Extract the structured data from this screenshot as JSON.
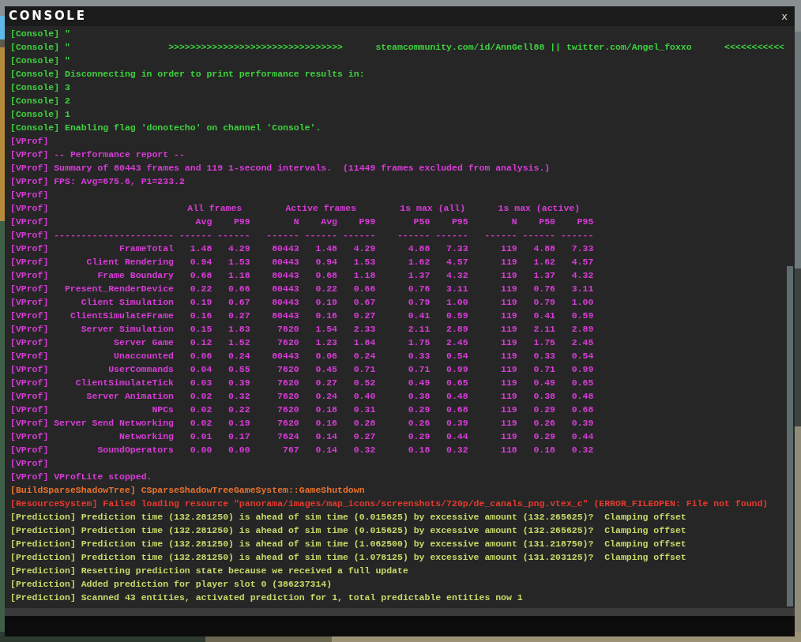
{
  "window": {
    "title": "CONSOLE",
    "close": "x"
  },
  "lines": [
    {
      "kind": "text",
      "color": "#3fd13f",
      "text": "[Console] \""
    },
    {
      "kind": "text",
      "color": "#3fd13f",
      "text": "[Console] \"                  >>>>>>>>>>>>>>>>>>>>>>>>>>>>>>>>      steamcommunity.com/id/AnnGell88 || twitter.com/Angel_foxxo      <<<<<<<<<<<"
    },
    {
      "kind": "text",
      "color": "#3fd13f",
      "text": "[Console] \""
    },
    {
      "kind": "text",
      "color": "#3fd13f",
      "text": "[Console] Disconnecting in order to print performance results in:"
    },
    {
      "kind": "text",
      "color": "#3fd13f",
      "text": "[Console] 3"
    },
    {
      "kind": "text",
      "color": "#3fd13f",
      "text": "[Console] 2"
    },
    {
      "kind": "text",
      "color": "#3fd13f",
      "text": "[Console] 1"
    },
    {
      "kind": "text",
      "color": "#3fd13f",
      "text": "[Console] Enabling flag 'donotecho' on channel 'Console'."
    },
    {
      "kind": "text",
      "color": "#d83cd8",
      "text": "[VProf]"
    },
    {
      "kind": "text",
      "color": "#d83cd8",
      "text": "[VProf] -- Performance report --"
    },
    {
      "kind": "text",
      "color": "#d83cd8",
      "text": "[VProf] Summary of 80443 frames and 119 1-second intervals.  (11449 frames excluded from analysis.)"
    },
    {
      "kind": "text",
      "color": "#d83cd8",
      "text": "[VProf] FPS: Avg=675.6, P1=233.2"
    },
    {
      "kind": "text",
      "color": "#d83cd8",
      "text": "[VProf]"
    },
    {
      "kind": "groups",
      "color": "#d83cd8",
      "prefix": "[VProf]",
      "groups": [
        "All frames",
        "Active frames",
        "1s max (all)",
        "1s max (active)"
      ]
    },
    {
      "kind": "row",
      "color": "#d83cd8",
      "prefix": "[VProf]",
      "values": [
        "Avg",
        "P99",
        "N",
        "Avg",
        "P99",
        "P50",
        "P95",
        "N",
        "P50",
        "P95"
      ]
    },
    {
      "kind": "row",
      "color": "#d83cd8",
      "prefix": "[VProf]",
      "name": "----------------------",
      "values": [
        "------",
        "------",
        "------",
        "------",
        "------",
        "------",
        "------",
        "------",
        "------",
        "------"
      ]
    },
    {
      "kind": "row",
      "color": "#d83cd8",
      "prefix": "[VProf]",
      "name": "FrameTotal",
      "values": [
        "1.48",
        "4.29",
        "80443",
        "1.48",
        "4.29",
        "4.88",
        "7.33",
        "119",
        "4.88",
        "7.33"
      ]
    },
    {
      "kind": "row",
      "color": "#d83cd8",
      "prefix": "[VProf]",
      "name": "Client Rendering",
      "values": [
        "0.94",
        "1.53",
        "80443",
        "0.94",
        "1.53",
        "1.62",
        "4.57",
        "119",
        "1.62",
        "4.57"
      ]
    },
    {
      "kind": "row",
      "color": "#d83cd8",
      "prefix": "[VProf]",
      "name": "Frame Boundary",
      "values": [
        "0.68",
        "1.18",
        "80443",
        "0.68",
        "1.18",
        "1.37",
        "4.32",
        "119",
        "1.37",
        "4.32"
      ]
    },
    {
      "kind": "row",
      "color": "#d83cd8",
      "prefix": "[VProf]",
      "name": "Present_RenderDevice",
      "values": [
        "0.22",
        "0.66",
        "80443",
        "0.22",
        "0.66",
        "0.76",
        "3.11",
        "119",
        "0.76",
        "3.11"
      ]
    },
    {
      "kind": "row",
      "color": "#d83cd8",
      "prefix": "[VProf]",
      "name": "Client Simulation",
      "values": [
        "0.19",
        "0.67",
        "80443",
        "0.19",
        "0.67",
        "0.79",
        "1.00",
        "119",
        "0.79",
        "1.00"
      ]
    },
    {
      "kind": "row",
      "color": "#d83cd8",
      "prefix": "[VProf]",
      "name": "ClientSimulateFrame",
      "values": [
        "0.16",
        "0.27",
        "80443",
        "0.16",
        "0.27",
        "0.41",
        "0.59",
        "119",
        "0.41",
        "0.59"
      ]
    },
    {
      "kind": "row",
      "color": "#d83cd8",
      "prefix": "[VProf]",
      "name": "Server Simulation",
      "values": [
        "0.15",
        "1.83",
        "7620",
        "1.54",
        "2.33",
        "2.11",
        "2.89",
        "119",
        "2.11",
        "2.89"
      ]
    },
    {
      "kind": "row",
      "color": "#d83cd8",
      "prefix": "[VProf]",
      "name": "Server Game",
      "values": [
        "0.12",
        "1.52",
        "7620",
        "1.23",
        "1.84",
        "1.75",
        "2.45",
        "119",
        "1.75",
        "2.45"
      ]
    },
    {
      "kind": "row",
      "color": "#d83cd8",
      "prefix": "[VProf]",
      "name": "Unaccounted",
      "values": [
        "0.06",
        "0.24",
        "80443",
        "0.06",
        "0.24",
        "0.33",
        "0.54",
        "119",
        "0.33",
        "0.54"
      ]
    },
    {
      "kind": "row",
      "color": "#d83cd8",
      "prefix": "[VProf]",
      "name": "UserCommands",
      "values": [
        "0.04",
        "0.55",
        "7620",
        "0.45",
        "0.71",
        "0.71",
        "0.99",
        "119",
        "0.71",
        "0.99"
      ]
    },
    {
      "kind": "row",
      "color": "#d83cd8",
      "prefix": "[VProf]",
      "name": "ClientSimulateTick",
      "values": [
        "0.03",
        "0.39",
        "7620",
        "0.27",
        "0.52",
        "0.49",
        "0.65",
        "119",
        "0.49",
        "0.65"
      ]
    },
    {
      "kind": "row",
      "color": "#d83cd8",
      "prefix": "[VProf]",
      "name": "Server Animation",
      "values": [
        "0.02",
        "0.32",
        "7620",
        "0.24",
        "0.40",
        "0.38",
        "0.48",
        "119",
        "0.38",
        "0.48"
      ]
    },
    {
      "kind": "row",
      "color": "#d83cd8",
      "prefix": "[VProf]",
      "name": "NPCs",
      "values": [
        "0.02",
        "0.22",
        "7620",
        "0.18",
        "0.31",
        "0.29",
        "0.68",
        "119",
        "0.29",
        "0.68"
      ]
    },
    {
      "kind": "row",
      "color": "#d83cd8",
      "prefix": "[VProf]",
      "name": "Server Send Networking",
      "values": [
        "0.02",
        "0.19",
        "7620",
        "0.16",
        "0.28",
        "0.26",
        "0.39",
        "119",
        "0.26",
        "0.39"
      ]
    },
    {
      "kind": "row",
      "color": "#d83cd8",
      "prefix": "[VProf]",
      "name": "Networking",
      "values": [
        "0.01",
        "0.17",
        "7624",
        "0.14",
        "0.27",
        "0.29",
        "0.44",
        "119",
        "0.29",
        "0.44"
      ]
    },
    {
      "kind": "row",
      "color": "#d83cd8",
      "prefix": "[VProf]",
      "name": "SoundOperators",
      "values": [
        "0.00",
        "0.00",
        "767",
        "0.14",
        "0.32",
        "0.18",
        "0.32",
        "118",
        "0.18",
        "0.32"
      ]
    },
    {
      "kind": "text",
      "color": "#d83cd8",
      "text": "[VProf]"
    },
    {
      "kind": "text",
      "color": "#d83cd8",
      "text": "[VProf] VProfLite stopped."
    },
    {
      "kind": "text",
      "color": "#e8722e",
      "text": "[BuildSparseShadowTree] CSparseShadowTreeGameSystem::GameShutdown"
    },
    {
      "kind": "text",
      "color": "#e63a2e",
      "text": "[ResourceSystem] Failed loading resource \"panorama/images/map_icons/screenshots/720p/de_canals_png.vtex_c\" (ERROR_FILEOPEN: File not found)"
    },
    {
      "kind": "text",
      "color": "#c9d96a",
      "text": "[Prediction] Prediction time (132.281250) is ahead of sim time (0.015625) by excessive amount (132.265625)?  Clamping offset"
    },
    {
      "kind": "text",
      "color": "#c9d96a",
      "text": "[Prediction] Prediction time (132.281250) is ahead of sim time (0.015625) by excessive amount (132.265625)?  Clamping offset"
    },
    {
      "kind": "text",
      "color": "#c9d96a",
      "text": "[Prediction] Prediction time (132.281250) is ahead of sim time (1.062500) by excessive amount (131.218750)?  Clamping offset"
    },
    {
      "kind": "text",
      "color": "#c9d96a",
      "text": "[Prediction] Prediction time (132.281250) is ahead of sim time (1.078125) by excessive amount (131.203125)?  Clamping offset"
    },
    {
      "kind": "text",
      "color": "#c9d96a",
      "text": "[Prediction] Resetting prediction state because we received a full update"
    },
    {
      "kind": "text",
      "color": "#c9d96a",
      "text": "[Prediction] Added prediction for player slot 0 (386237314)"
    },
    {
      "kind": "text",
      "color": "#c9d96a",
      "text": "[Prediction] Scanned 43 entities, activated prediction for 1, total predictable entities now 1"
    }
  ]
}
